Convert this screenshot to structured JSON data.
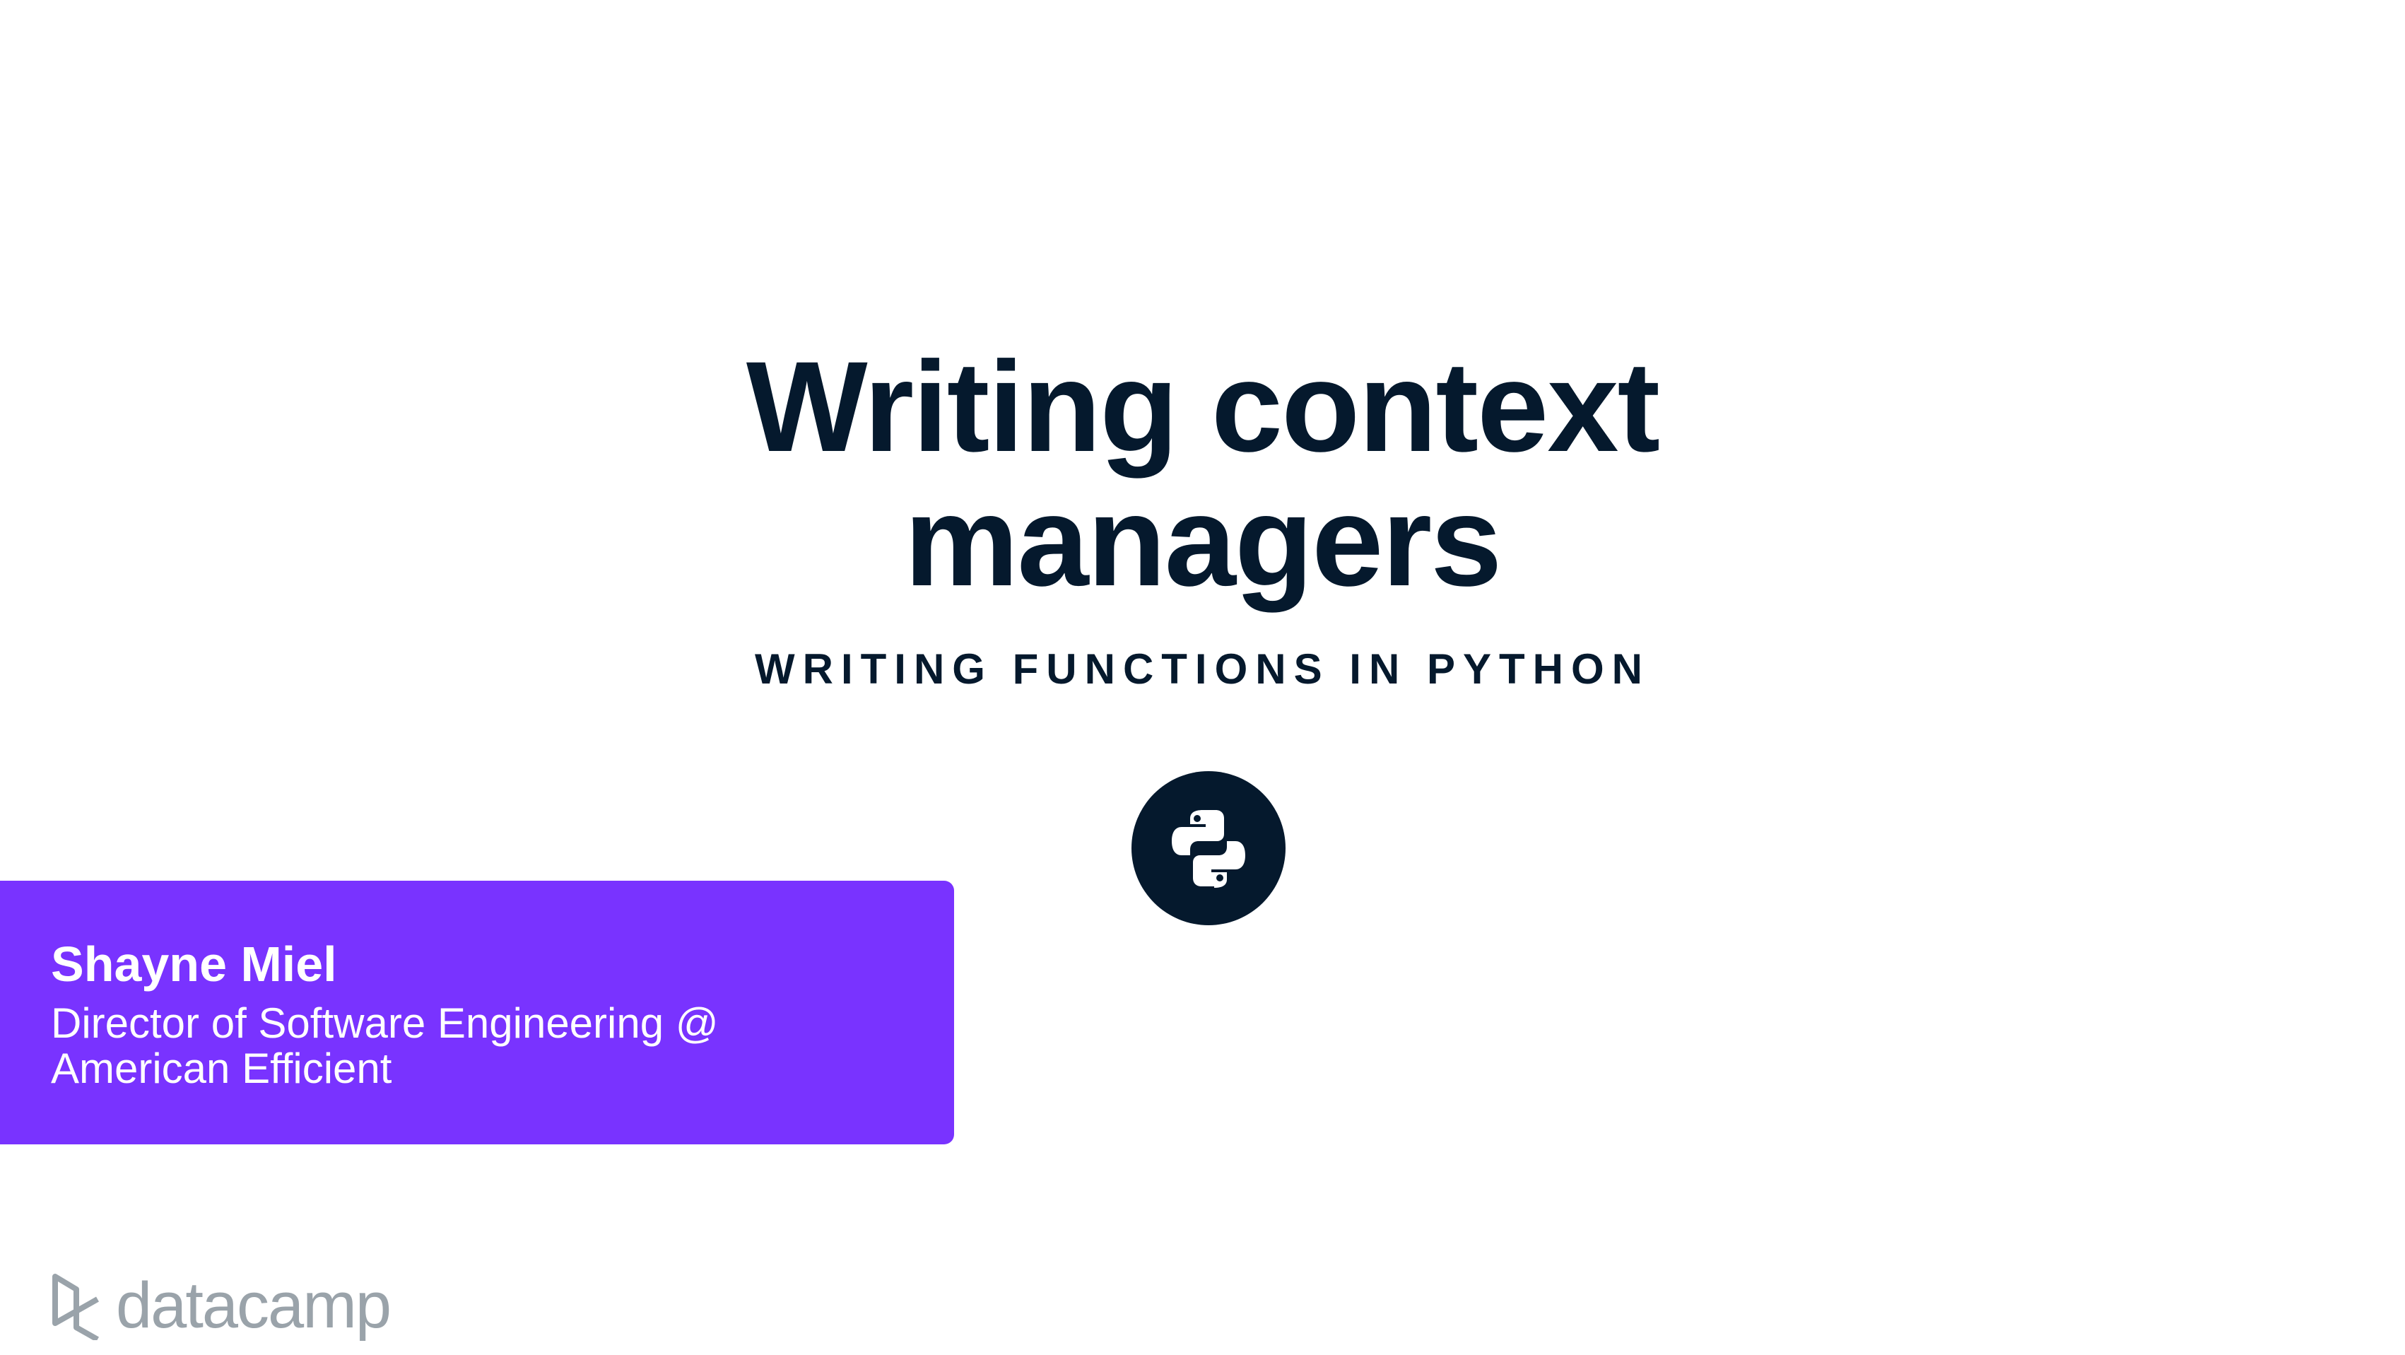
{
  "slide": {
    "title_line1": "Writing context",
    "title_line2": "managers",
    "course": "WRITING FUNCTIONS IN PYTHON"
  },
  "presenter": {
    "name": "Shayne Miel",
    "role": "Director of Software Engineering @ American Efficient"
  },
  "brand": {
    "logo_text": "datacamp",
    "accent_color": "#7933ff",
    "dark_color": "#05192d"
  }
}
